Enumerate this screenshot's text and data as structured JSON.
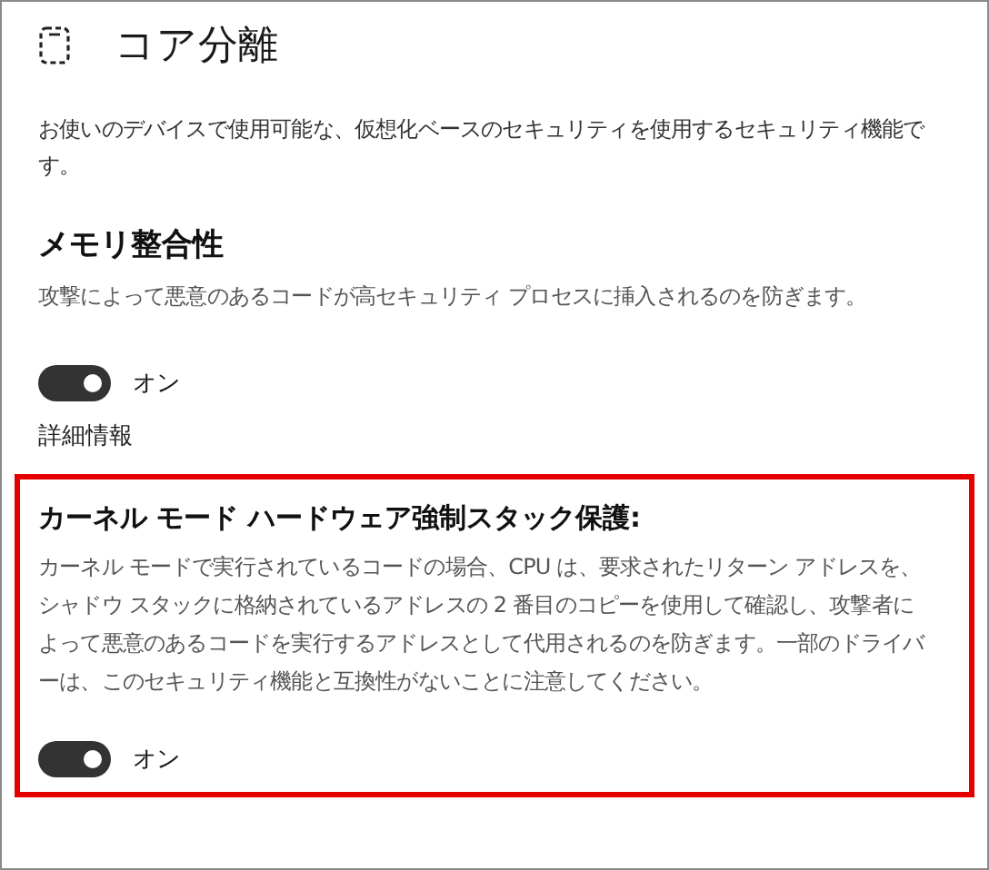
{
  "title": "コア分離",
  "description": "お使いのデバイスで使用可能な、仮想化ベースのセキュリティを使用するセキュリティ機能です。",
  "sections": [
    {
      "heading": "メモリ整合性",
      "description": "攻撃によって悪意のあるコードが高セキュリティ プロセスに挿入されるのを防ぎます。",
      "toggle": {
        "on": true,
        "label": "オン"
      },
      "link": "詳細情報",
      "highlighted": false
    },
    {
      "heading": "カーネル モード ハードウェア強制スタック保護:",
      "description": "カーネル モードで実行されているコードの場合、CPU は、要求されたリターン アドレスを、シャドウ スタックに格納されているアドレスの 2 番目のコピーを使用して確認し、攻撃者によって悪意のあるコードを実行するアドレスとして代用されるのを防ぎます。一部のドライバーは、このセキュリティ機能と互換性がないことに注意してください。",
      "toggle": {
        "on": true,
        "label": "オン"
      },
      "highlighted": true
    }
  ]
}
